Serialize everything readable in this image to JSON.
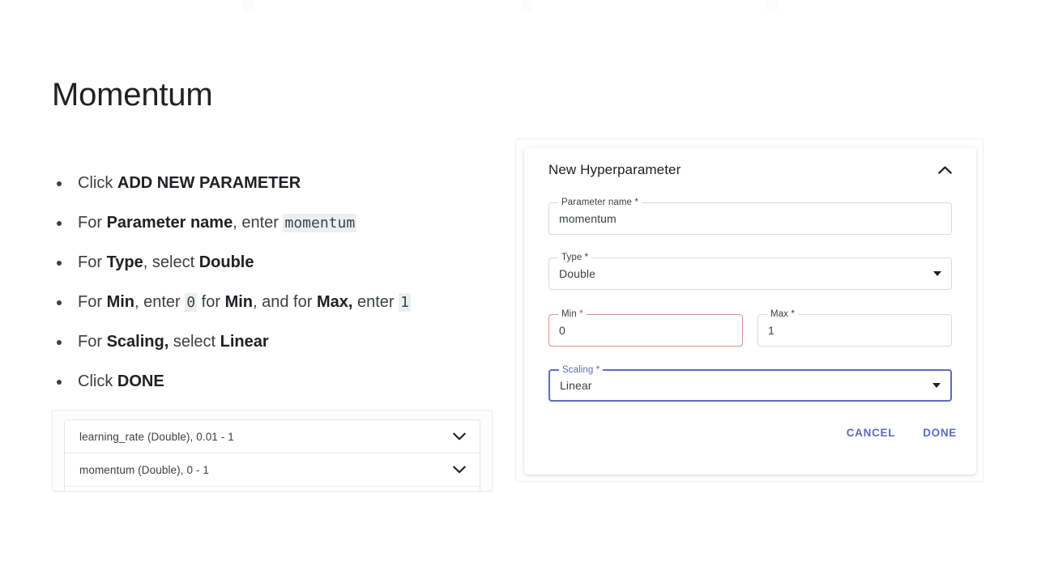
{
  "slide": {
    "title": "Momentum"
  },
  "instructions": [
    {
      "id": "add-new-parameter",
      "parts": [
        {
          "text": "Click ",
          "style": "normal"
        },
        {
          "text": "ADD NEW PARAMETER",
          "style": "bold"
        }
      ]
    },
    {
      "id": "parameter-name",
      "parts": [
        {
          "text": "For ",
          "style": "normal"
        },
        {
          "text": "Parameter name",
          "style": "bold"
        },
        {
          "text": ", enter ",
          "style": "normal"
        },
        {
          "text": "momentum",
          "style": "code"
        }
      ]
    },
    {
      "id": "type",
      "parts": [
        {
          "text": "For ",
          "style": "normal"
        },
        {
          "text": "Type",
          "style": "bold"
        },
        {
          "text": ", select ",
          "style": "normal"
        },
        {
          "text": "Double",
          "style": "bold"
        }
      ]
    },
    {
      "id": "min-max",
      "parts": [
        {
          "text": "For ",
          "style": "normal"
        },
        {
          "text": "Min",
          "style": "bold"
        },
        {
          "text": ", enter ",
          "style": "normal"
        },
        {
          "text": "0",
          "style": "code"
        },
        {
          "text": " for ",
          "style": "normal"
        },
        {
          "text": "Min",
          "style": "bold"
        },
        {
          "text": ", and for ",
          "style": "normal"
        },
        {
          "text": "Max,",
          "style": "bold"
        },
        {
          "text": " enter ",
          "style": "normal"
        },
        {
          "text": "1",
          "style": "code"
        }
      ]
    },
    {
      "id": "scaling",
      "parts": [
        {
          "text": "For ",
          "style": "normal"
        },
        {
          "text": "Scaling,",
          "style": "bold"
        },
        {
          "text": " select ",
          "style": "normal"
        },
        {
          "text": "Linear",
          "style": "bold"
        }
      ]
    },
    {
      "id": "done",
      "parts": [
        {
          "text": "Click ",
          "style": "normal"
        },
        {
          "text": "DONE",
          "style": "bold"
        }
      ]
    }
  ],
  "param_list": {
    "rows": [
      {
        "label": "learning_rate (Double), 0.01 - 1",
        "icon": "chevron-down-icon"
      },
      {
        "label": "momentum (Double), 0 - 1",
        "icon": "chevron-down-icon"
      }
    ]
  },
  "card": {
    "title": "New Hyperparameter",
    "collapse_icon": "chevron-up-icon",
    "fields": {
      "parameter_name": {
        "label": "Parameter name *",
        "label_text": "Parameter name",
        "required_marker": "*",
        "value": "momentum",
        "state": "filled"
      },
      "type": {
        "label": "Type *",
        "label_text": "Type",
        "required_marker": "*",
        "value": "Double",
        "state": "filled",
        "control": "select",
        "icon": "dropdown-arrow-icon"
      },
      "min": {
        "label": "Min *",
        "label_text": "Min",
        "required_marker": "*",
        "value": "0",
        "state": "error"
      },
      "max": {
        "label": "Max *",
        "label_text": "Max",
        "required_marker": "*",
        "value": "1",
        "state": "filled"
      },
      "scaling": {
        "label": "Scaling *",
        "label_text": "Scaling",
        "required_marker": "*",
        "value": "Linear",
        "state": "focused",
        "control": "select",
        "icon": "dropdown-arrow-icon"
      }
    },
    "actions": {
      "cancel_label": "CANCEL",
      "done_label": "DONE"
    }
  },
  "colors": {
    "accent_blue": "#5c6bc0",
    "error_red": "#d98d97",
    "required_red": "#e53935",
    "text_primary": "#202124",
    "text_secondary": "#3c4043",
    "border": "#dadce0",
    "code_bg": "#eceff1"
  }
}
